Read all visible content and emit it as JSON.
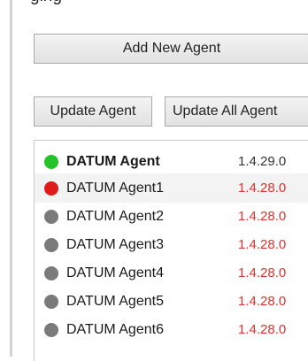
{
  "header": {
    "partial_text": "ging"
  },
  "buttons": {
    "add_new_agent": "Add New Agent",
    "update_agent": "Update Agent",
    "update_all_agents": "Update All Agent"
  },
  "agents": [
    {
      "name": "DATUM Agent",
      "version": "1.4.29.0",
      "status": "online",
      "status_color": "#22c42a",
      "version_color": "#333333",
      "bold": true
    },
    {
      "name": "DATUM Agent1",
      "version": "1.4.28.0",
      "status": "error",
      "status_color": "#e01b1b",
      "version_color": "#e0322f",
      "bold": false
    },
    {
      "name": "DATUM Agent2",
      "version": "1.4.28.0",
      "status": "offline",
      "status_color": "#7a7a7a",
      "version_color": "#e0322f",
      "bold": false
    },
    {
      "name": "DATUM Agent3",
      "version": "1.4.28.0",
      "status": "offline",
      "status_color": "#7a7a7a",
      "version_color": "#e0322f",
      "bold": false
    },
    {
      "name": "DATUM Agent4",
      "version": "1.4.28.0",
      "status": "offline",
      "status_color": "#7a7a7a",
      "version_color": "#e0322f",
      "bold": false
    },
    {
      "name": "DATUM Agent5",
      "version": "1.4.28.0",
      "status": "offline",
      "status_color": "#7a7a7a",
      "version_color": "#e0322f",
      "bold": false
    },
    {
      "name": "DATUM Agent6",
      "version": "1.4.28.0",
      "status": "offline",
      "status_color": "#7a7a7a",
      "version_color": "#e0322f",
      "bold": false
    }
  ]
}
